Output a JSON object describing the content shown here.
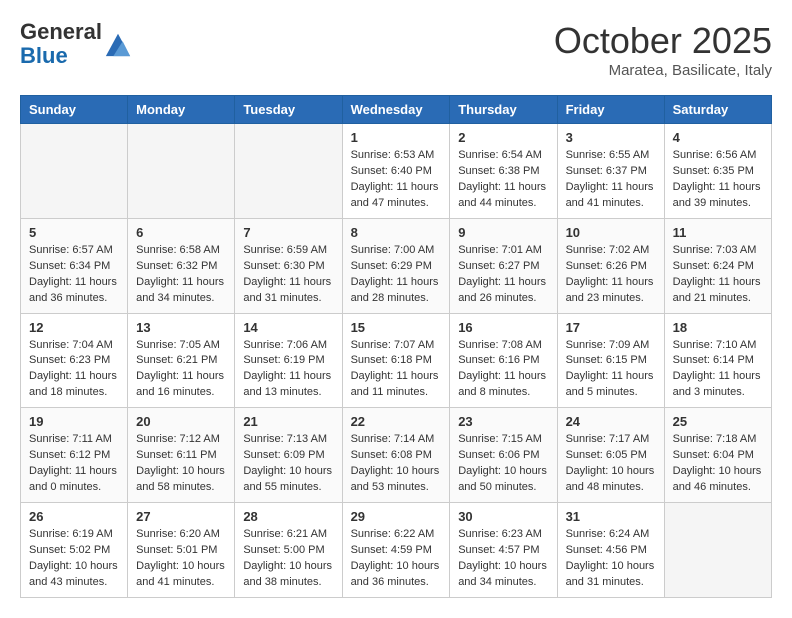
{
  "header": {
    "logo_line1": "General",
    "logo_line2": "Blue",
    "month_title": "October 2025",
    "subtitle": "Maratea, Basilicate, Italy"
  },
  "days_of_week": [
    "Sunday",
    "Monday",
    "Tuesday",
    "Wednesday",
    "Thursday",
    "Friday",
    "Saturday"
  ],
  "weeks": [
    [
      {
        "day": "",
        "info": ""
      },
      {
        "day": "",
        "info": ""
      },
      {
        "day": "",
        "info": ""
      },
      {
        "day": "1",
        "info": "Sunrise: 6:53 AM\nSunset: 6:40 PM\nDaylight: 11 hours and 47 minutes."
      },
      {
        "day": "2",
        "info": "Sunrise: 6:54 AM\nSunset: 6:38 PM\nDaylight: 11 hours and 44 minutes."
      },
      {
        "day": "3",
        "info": "Sunrise: 6:55 AM\nSunset: 6:37 PM\nDaylight: 11 hours and 41 minutes."
      },
      {
        "day": "4",
        "info": "Sunrise: 6:56 AM\nSunset: 6:35 PM\nDaylight: 11 hours and 39 minutes."
      }
    ],
    [
      {
        "day": "5",
        "info": "Sunrise: 6:57 AM\nSunset: 6:34 PM\nDaylight: 11 hours and 36 minutes."
      },
      {
        "day": "6",
        "info": "Sunrise: 6:58 AM\nSunset: 6:32 PM\nDaylight: 11 hours and 34 minutes."
      },
      {
        "day": "7",
        "info": "Sunrise: 6:59 AM\nSunset: 6:30 PM\nDaylight: 11 hours and 31 minutes."
      },
      {
        "day": "8",
        "info": "Sunrise: 7:00 AM\nSunset: 6:29 PM\nDaylight: 11 hours and 28 minutes."
      },
      {
        "day": "9",
        "info": "Sunrise: 7:01 AM\nSunset: 6:27 PM\nDaylight: 11 hours and 26 minutes."
      },
      {
        "day": "10",
        "info": "Sunrise: 7:02 AM\nSunset: 6:26 PM\nDaylight: 11 hours and 23 minutes."
      },
      {
        "day": "11",
        "info": "Sunrise: 7:03 AM\nSunset: 6:24 PM\nDaylight: 11 hours and 21 minutes."
      }
    ],
    [
      {
        "day": "12",
        "info": "Sunrise: 7:04 AM\nSunset: 6:23 PM\nDaylight: 11 hours and 18 minutes."
      },
      {
        "day": "13",
        "info": "Sunrise: 7:05 AM\nSunset: 6:21 PM\nDaylight: 11 hours and 16 minutes."
      },
      {
        "day": "14",
        "info": "Sunrise: 7:06 AM\nSunset: 6:19 PM\nDaylight: 11 hours and 13 minutes."
      },
      {
        "day": "15",
        "info": "Sunrise: 7:07 AM\nSunset: 6:18 PM\nDaylight: 11 hours and 11 minutes."
      },
      {
        "day": "16",
        "info": "Sunrise: 7:08 AM\nSunset: 6:16 PM\nDaylight: 11 hours and 8 minutes."
      },
      {
        "day": "17",
        "info": "Sunrise: 7:09 AM\nSunset: 6:15 PM\nDaylight: 11 hours and 5 minutes."
      },
      {
        "day": "18",
        "info": "Sunrise: 7:10 AM\nSunset: 6:14 PM\nDaylight: 11 hours and 3 minutes."
      }
    ],
    [
      {
        "day": "19",
        "info": "Sunrise: 7:11 AM\nSunset: 6:12 PM\nDaylight: 11 hours and 0 minutes."
      },
      {
        "day": "20",
        "info": "Sunrise: 7:12 AM\nSunset: 6:11 PM\nDaylight: 10 hours and 58 minutes."
      },
      {
        "day": "21",
        "info": "Sunrise: 7:13 AM\nSunset: 6:09 PM\nDaylight: 10 hours and 55 minutes."
      },
      {
        "day": "22",
        "info": "Sunrise: 7:14 AM\nSunset: 6:08 PM\nDaylight: 10 hours and 53 minutes."
      },
      {
        "day": "23",
        "info": "Sunrise: 7:15 AM\nSunset: 6:06 PM\nDaylight: 10 hours and 50 minutes."
      },
      {
        "day": "24",
        "info": "Sunrise: 7:17 AM\nSunset: 6:05 PM\nDaylight: 10 hours and 48 minutes."
      },
      {
        "day": "25",
        "info": "Sunrise: 7:18 AM\nSunset: 6:04 PM\nDaylight: 10 hours and 46 minutes."
      }
    ],
    [
      {
        "day": "26",
        "info": "Sunrise: 6:19 AM\nSunset: 5:02 PM\nDaylight: 10 hours and 43 minutes."
      },
      {
        "day": "27",
        "info": "Sunrise: 6:20 AM\nSunset: 5:01 PM\nDaylight: 10 hours and 41 minutes."
      },
      {
        "day": "28",
        "info": "Sunrise: 6:21 AM\nSunset: 5:00 PM\nDaylight: 10 hours and 38 minutes."
      },
      {
        "day": "29",
        "info": "Sunrise: 6:22 AM\nSunset: 4:59 PM\nDaylight: 10 hours and 36 minutes."
      },
      {
        "day": "30",
        "info": "Sunrise: 6:23 AM\nSunset: 4:57 PM\nDaylight: 10 hours and 34 minutes."
      },
      {
        "day": "31",
        "info": "Sunrise: 6:24 AM\nSunset: 4:56 PM\nDaylight: 10 hours and 31 minutes."
      },
      {
        "day": "",
        "info": ""
      }
    ]
  ]
}
